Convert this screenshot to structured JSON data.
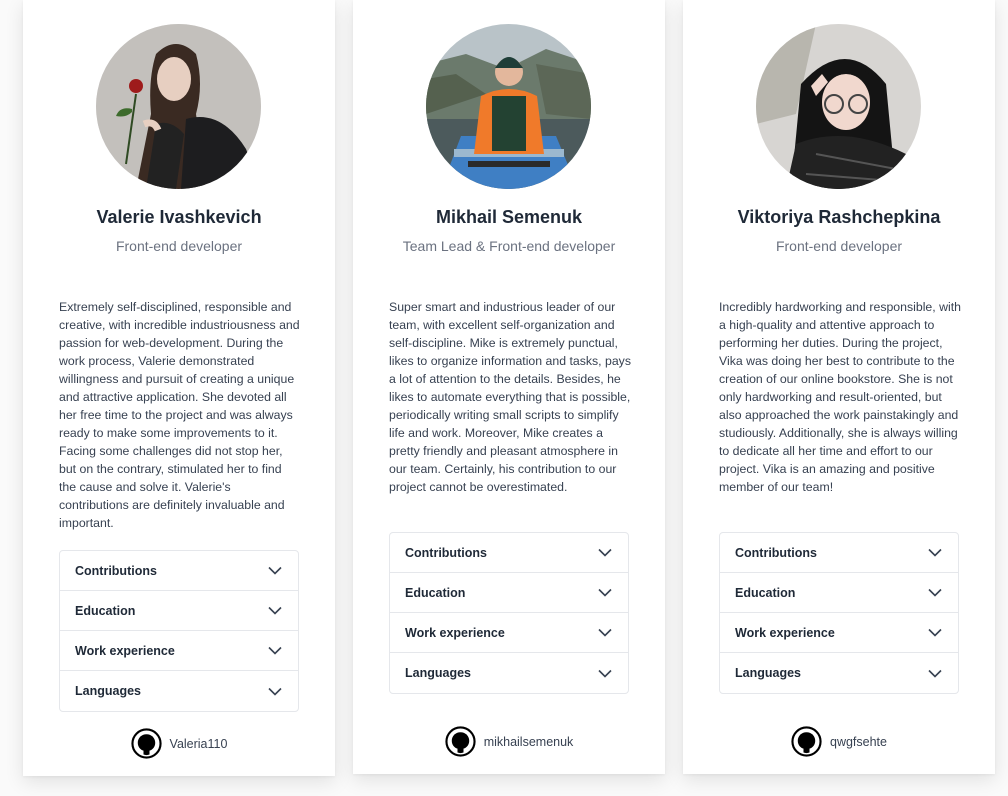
{
  "cards": [
    {
      "name": "Valerie Ivashkevich",
      "role": "Front-end developer",
      "bio": "Extremely self-disciplined, responsible and creative, with incredible industriousness and passion for web-development. During the work process, Valerie demonstrated willingness and pursuit of creating a unique and attractive application. She devoted all her free time to the project and was always ready to make some improvements to it. Facing some challenges did not stop her, but on the contrary, stimulated her to find the cause and solve it. Valerie's contributions are definitely invaluable and important.",
      "sections": [
        "Contributions",
        "Education",
        "Work experience",
        "Languages"
      ],
      "github": "Valeria110",
      "github_icon": "github-icon",
      "expand_icon": "chevron-down-icon"
    },
    {
      "name": "Mikhail Semenuk",
      "role": "Team Lead & Front-end developer",
      "bio": "Super smart and industrious leader of our team, with excellent self-organization and self-discipline. Mike is extremely punctual, likes to organize information and tasks, pays a lot of attention to the details. Besides, he likes to automate everything that is possible, periodically writing small scripts to simplify life and work. Moreover, Mike creates a pretty friendly and pleasant atmosphere in our team. Certainly, his contribution to our project cannot be overestimated.",
      "sections": [
        "Contributions",
        "Education",
        "Work experience",
        "Languages"
      ],
      "github": "mikhailsemenuk",
      "github_icon": "github-icon",
      "expand_icon": "chevron-down-icon"
    },
    {
      "name": "Viktoriya Rashchepkina",
      "role": "Front-end developer",
      "bio": "Incredibly hardworking and responsible, with a high-quality and attentive approach to performing her duties. During the project, Vika was doing her best to contribute to the creation of our online bookstore. She is not only hardworking and result-oriented, but also approached the work painstakingly and studiously. Additionally, she is always willing to dedicate all her time and effort to our project. Vika is an amazing and positive member of our team!",
      "sections": [
        "Contributions",
        "Education",
        "Work experience",
        "Languages"
      ],
      "github": "qwgfsehte",
      "github_icon": "github-icon",
      "expand_icon": "chevron-down-icon"
    }
  ]
}
